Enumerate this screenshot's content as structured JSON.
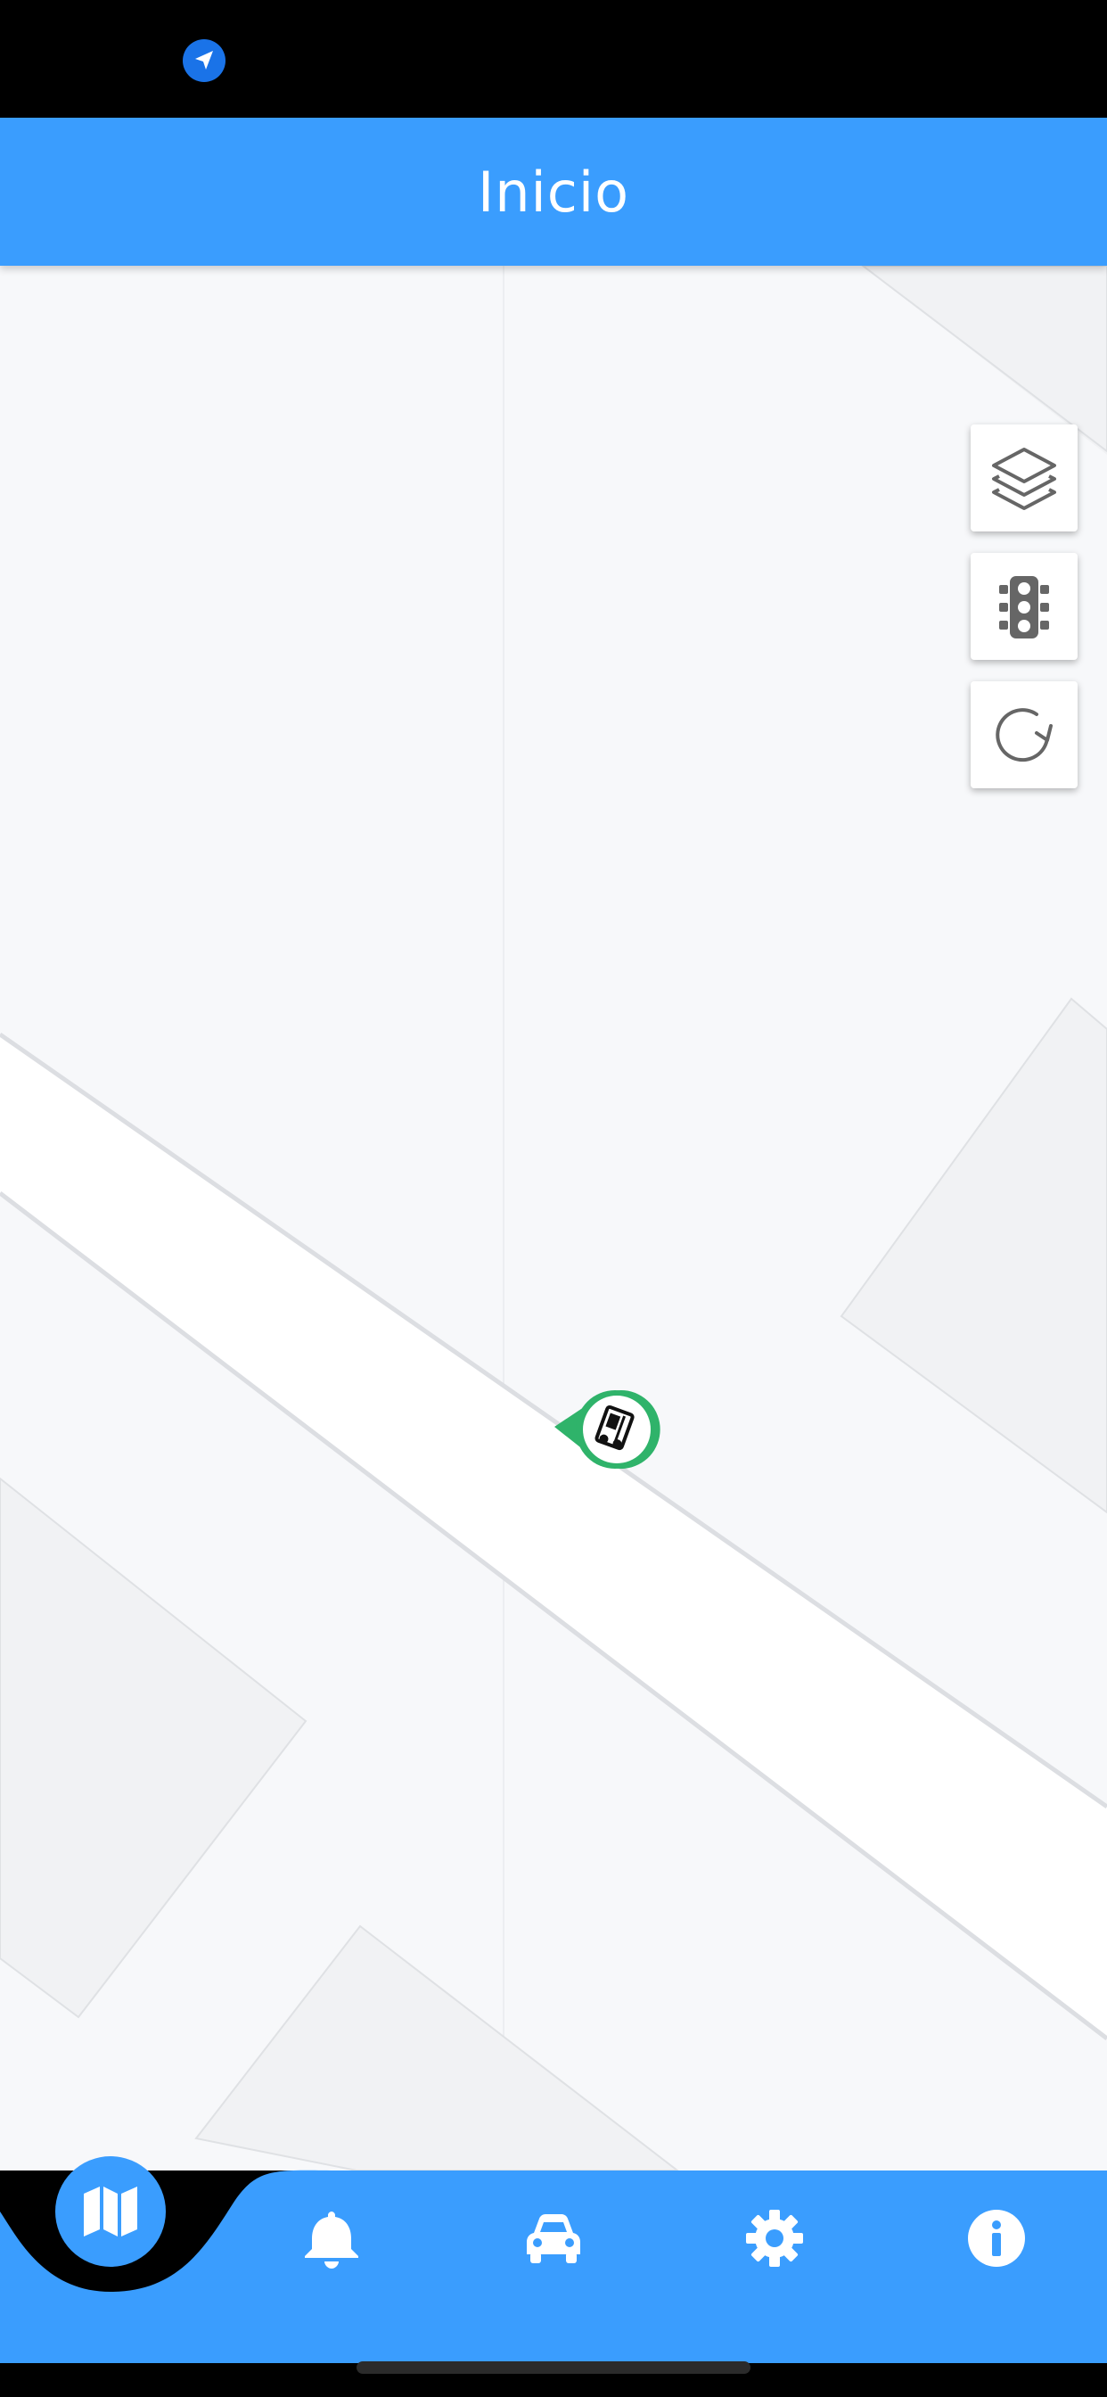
{
  "header": {
    "title": "Inicio"
  },
  "status_bar": {
    "icons": [
      "location-arrow-icon"
    ]
  },
  "map_controls": [
    {
      "name": "layers-button",
      "icon": "layers-icon"
    },
    {
      "name": "traffic-button",
      "icon": "traffic-light-icon"
    },
    {
      "name": "refresh-button",
      "icon": "refresh-icon"
    }
  ],
  "vehicle_marker": {
    "icon": "truck-icon",
    "color": "#2fb36a"
  },
  "bottom_nav": {
    "items": [
      {
        "name": "nav-map",
        "icon": "map-icon",
        "active": true
      },
      {
        "name": "nav-notifications",
        "icon": "bell-icon",
        "active": false
      },
      {
        "name": "nav-vehicles",
        "icon": "car-icon",
        "active": false
      },
      {
        "name": "nav-settings",
        "icon": "gear-icon",
        "active": false
      },
      {
        "name": "nav-info",
        "icon": "info-icon",
        "active": false
      }
    ]
  },
  "colors": {
    "primary": "#3a9dfe",
    "map_background": "#f7f8fa",
    "road": "#ffffff",
    "marker": "#2fb36a"
  }
}
